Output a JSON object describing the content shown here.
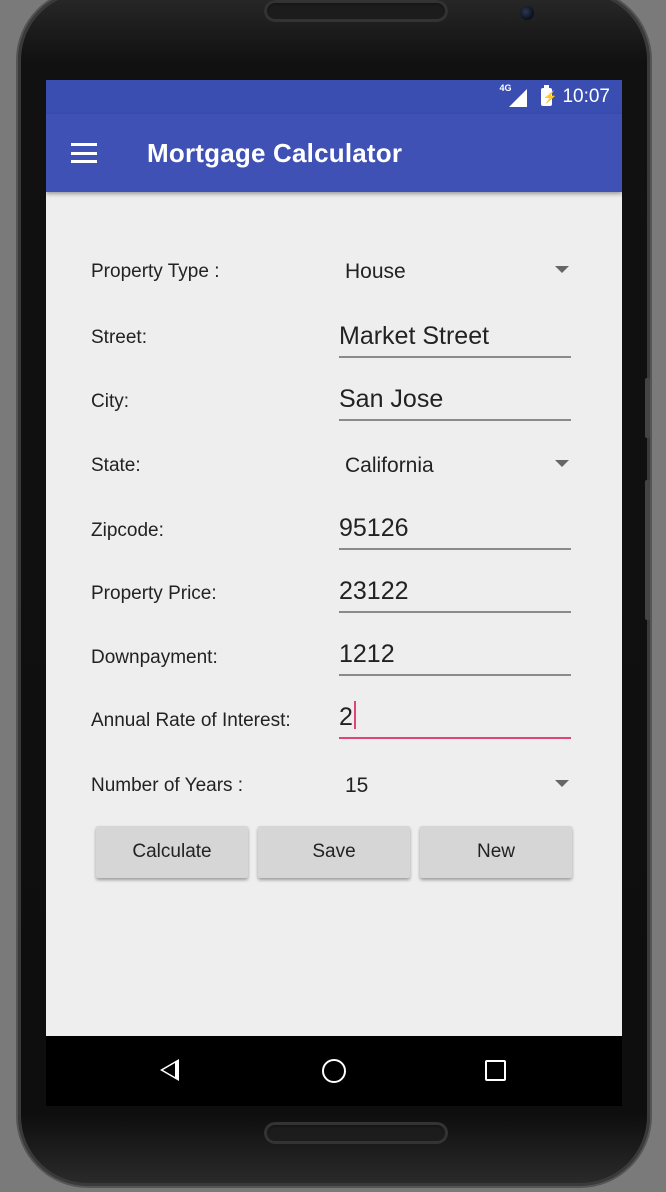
{
  "status_bar": {
    "network": "4G",
    "time": "10:07"
  },
  "app_bar": {
    "title": "Mortgage Calculator",
    "menu_icon": "hamburger-menu-icon"
  },
  "form": {
    "property_type": {
      "label": "Property Type :",
      "value": "House"
    },
    "street": {
      "label": "Street:",
      "value": "Market Street"
    },
    "city": {
      "label": "City:",
      "value": "San Jose"
    },
    "state": {
      "label": "State:",
      "value": "California"
    },
    "zipcode": {
      "label": "Zipcode:",
      "value": "95126"
    },
    "property_price": {
      "label": "Property Price:",
      "value": "23122"
    },
    "downpayment": {
      "label": "Downpayment:",
      "value": "1212"
    },
    "interest": {
      "label": "Annual Rate of Interest:",
      "value": "2"
    },
    "years": {
      "label": "Number of Years :",
      "value": "15"
    }
  },
  "buttons": {
    "calculate": "Calculate",
    "save": "Save",
    "new": "New"
  },
  "colors": {
    "primary": "#3f51b5",
    "status": "#3a4db0",
    "accent": "#e3417a",
    "background": "#eeeeee"
  }
}
